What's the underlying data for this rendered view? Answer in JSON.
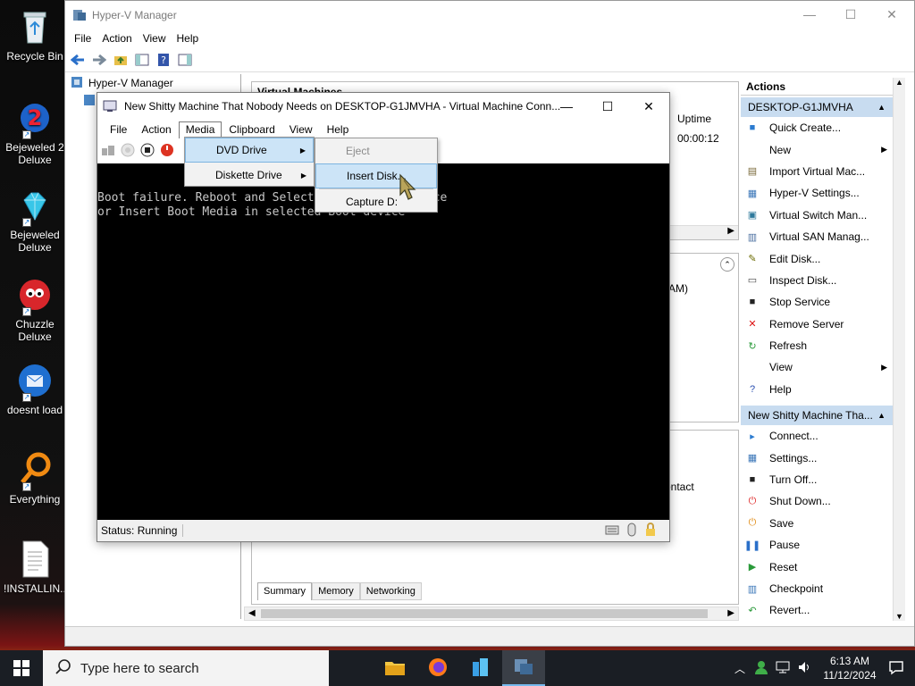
{
  "desktop": {
    "icons": [
      {
        "label": "Recycle Bin"
      },
      {
        "label": "Bejeweled 2 Deluxe"
      },
      {
        "label": "Bejeweled Deluxe"
      },
      {
        "label": "Chuzzle Deluxe"
      },
      {
        "label": "doesnt load"
      },
      {
        "label": "Everything"
      },
      {
        "label": "!INSTALLIN..."
      }
    ]
  },
  "hyperv": {
    "title": "Hyper-V Manager",
    "menu": [
      "File",
      "Action",
      "View",
      "Help"
    ],
    "tree_root": "Hyper-V Manager",
    "vm_panel_title": "Virtual Machines",
    "uptime_header": "Uptime",
    "uptime_value": "00:00:12",
    "checkpoint_text": "AM)",
    "contact_text": "ontact",
    "tabs": [
      "Summary",
      "Memory",
      "Networking"
    ],
    "actions": {
      "header": "Actions",
      "server_section": "DESKTOP-G1JMVHA",
      "server_items": [
        {
          "label": "Quick Create...",
          "icon": "quick-create-icon",
          "submenu": false
        },
        {
          "label": "New",
          "icon": "new-icon",
          "submenu": true
        },
        {
          "label": "Import Virtual Mac...",
          "icon": "import-icon",
          "submenu": false
        },
        {
          "label": "Hyper-V Settings...",
          "icon": "settings-icon",
          "submenu": false
        },
        {
          "label": "Virtual Switch Man...",
          "icon": "switch-icon",
          "submenu": false
        },
        {
          "label": "Virtual SAN Manag...",
          "icon": "san-icon",
          "submenu": false
        },
        {
          "label": "Edit Disk...",
          "icon": "edit-disk-icon",
          "submenu": false
        },
        {
          "label": "Inspect Disk...",
          "icon": "inspect-disk-icon",
          "submenu": false
        },
        {
          "label": "Stop Service",
          "icon": "stop-icon",
          "submenu": false
        },
        {
          "label": "Remove Server",
          "icon": "remove-icon",
          "submenu": false
        },
        {
          "label": "Refresh",
          "icon": "refresh-icon",
          "submenu": false
        },
        {
          "label": "View",
          "icon": "",
          "submenu": true
        },
        {
          "label": "Help",
          "icon": "help-icon",
          "submenu": false
        }
      ],
      "vm_section": "New Shitty Machine Tha...",
      "vm_items": [
        {
          "label": "Connect...",
          "icon": "connect-icon"
        },
        {
          "label": "Settings...",
          "icon": "vm-settings-icon"
        },
        {
          "label": "Turn Off...",
          "icon": "turn-off-icon"
        },
        {
          "label": "Shut Down...",
          "icon": "shutdown-icon"
        },
        {
          "label": "Save",
          "icon": "save-icon"
        },
        {
          "label": "Pause",
          "icon": "pause-icon"
        },
        {
          "label": "Reset",
          "icon": "reset-icon"
        },
        {
          "label": "Checkpoint",
          "icon": "checkpoint-icon"
        },
        {
          "label": "Revert...",
          "icon": "revert-icon"
        }
      ]
    }
  },
  "vmconnect": {
    "title": "New Shitty Machine That Nobody Needs on DESKTOP-G1JMVHA - Virtual Machine Conn...",
    "menu": [
      "File",
      "Action",
      "Media",
      "Clipboard",
      "View",
      "Help"
    ],
    "active_menu": "Media",
    "screen_lines": [
      "Boot failure. Reboot and Select proper Boot device",
      "or Insert Boot Media in selected Boot device"
    ],
    "status": "Status: Running"
  },
  "media_menu": {
    "items": [
      {
        "label": "DVD Drive",
        "submenu": true
      },
      {
        "label": "Diskette Drive",
        "submenu": true
      }
    ]
  },
  "dvd_submenu": {
    "items": [
      {
        "label": "Eject",
        "disabled": true
      },
      {
        "label": "Insert Disk...",
        "disabled": false
      },
      {
        "label": "Capture D:",
        "disabled": false
      }
    ]
  },
  "taskbar": {
    "search_placeholder": "Type here to search",
    "time": "6:13 AM",
    "date": "11/12/2024"
  }
}
